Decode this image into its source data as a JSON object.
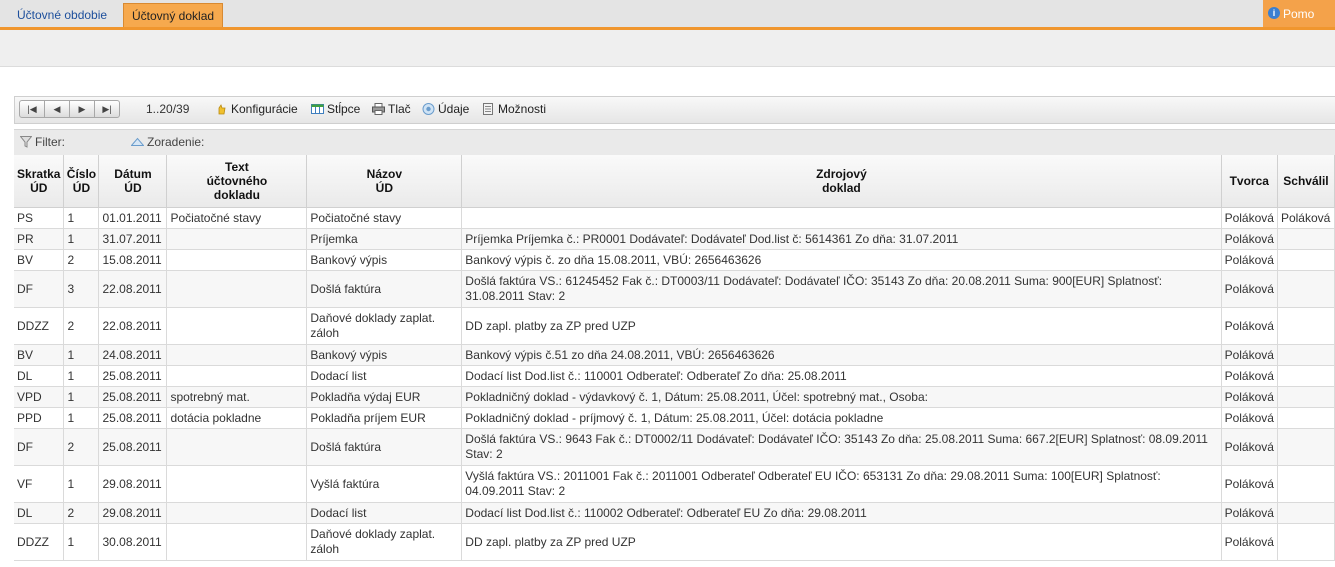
{
  "tabs": [
    {
      "label": "Účtovné obdobie",
      "active": false
    },
    {
      "label": "Účtovný doklad",
      "active": true
    }
  ],
  "help_label": "Pomo",
  "toolbar": {
    "page_info": "1..20/39",
    "konfiguracie": "Konfigurácie",
    "stlpce": "Stĺpce",
    "tlac": "Tlač",
    "udaje": "Údaje",
    "moznosti": "Možnosti"
  },
  "filterbar": {
    "filter": "Filter:",
    "zoradenie": "Zoradenie:"
  },
  "columns": [
    {
      "l1": "Skratka",
      "l2": "ÚD",
      "l3": ""
    },
    {
      "l1": "Číslo",
      "l2": "ÚD",
      "l3": ""
    },
    {
      "l1": "Dátum",
      "l2": "ÚD",
      "l3": ""
    },
    {
      "l1": "Text",
      "l2": "účtovného",
      "l3": "dokladu"
    },
    {
      "l1": "Názov",
      "l2": "ÚD",
      "l3": ""
    },
    {
      "l1": "Zdrojový",
      "l2": "doklad",
      "l3": ""
    },
    {
      "l1": "Tvorca",
      "l2": "",
      "l3": ""
    },
    {
      "l1": "Schválil",
      "l2": "",
      "l3": ""
    }
  ],
  "rows": [
    {
      "skratka": "PS",
      "cislo": "1",
      "datum": "01.01.2011",
      "text": "Počiatočné stavy",
      "nazov": "Počiatočné stavy",
      "zdroj": "",
      "tvorca": "Poláková",
      "schvalil": "Poláková"
    },
    {
      "skratka": "PR",
      "cislo": "1",
      "datum": "31.07.2011",
      "text": "",
      "nazov": "Príjemka",
      "zdroj": "Príjemka Príjemka č.: PR0001 Dodávateľ: Dodávateľ Dod.list č: 5614361 Zo dňa: 31.07.2011",
      "tvorca": "Poláková",
      "schvalil": ""
    },
    {
      "skratka": "BV",
      "cislo": "2",
      "datum": "15.08.2011",
      "text": "",
      "nazov": "Bankový výpis",
      "zdroj": "Bankový výpis č. zo dňa 15.08.2011, VBÚ: 2656463626",
      "tvorca": "Poláková",
      "schvalil": ""
    },
    {
      "skratka": "DF",
      "cislo": "3",
      "datum": "22.08.2011",
      "text": "",
      "nazov": "Došlá faktúra",
      "zdroj": "Došlá faktúra VS.: 61245452 Fak č.: DT0003/11 Dodávateľ: Dodávateľ IČO: 35143 Zo dňa: 20.08.2011 Suma: 900[EUR] Splatnosť: 31.08.2011 Stav: 2",
      "tvorca": "Poláková",
      "schvalil": ""
    },
    {
      "skratka": "DDZZ",
      "cislo": "2",
      "datum": "22.08.2011",
      "text": "",
      "nazov": "Daňové doklady zaplat. záloh",
      "zdroj": "DD zapl. platby za ZP pred UZP",
      "tvorca": "Poláková",
      "schvalil": ""
    },
    {
      "skratka": "BV",
      "cislo": "1",
      "datum": "24.08.2011",
      "text": "",
      "nazov": "Bankový výpis",
      "zdroj": "Bankový výpis č.51 zo dňa 24.08.2011, VBÚ: 2656463626",
      "tvorca": "Poláková",
      "schvalil": ""
    },
    {
      "skratka": "DL",
      "cislo": "1",
      "datum": "25.08.2011",
      "text": "",
      "nazov": "Dodací list",
      "zdroj": "Dodací list Dod.list č.: 110001 Odberateľ: Odberateľ Zo dňa: 25.08.2011",
      "tvorca": "Poláková",
      "schvalil": ""
    },
    {
      "skratka": "VPD",
      "cislo": "1",
      "datum": "25.08.2011",
      "text": "spotrebný mat.",
      "nazov": "Pokladňa výdaj EUR",
      "zdroj": "Pokladničný doklad - výdavkový č. 1, Dátum: 25.08.2011, Účel: spotrebný mat., Osoba:",
      "tvorca": "Poláková",
      "schvalil": ""
    },
    {
      "skratka": "PPD",
      "cislo": "1",
      "datum": "25.08.2011",
      "text": "dotácia pokladne",
      "nazov": "Pokladňa príjem EUR",
      "zdroj": "Pokladničný doklad - príjmový č. 1, Dátum: 25.08.2011, Účel: dotácia pokladne",
      "tvorca": "Poláková",
      "schvalil": ""
    },
    {
      "skratka": "DF",
      "cislo": "2",
      "datum": "25.08.2011",
      "text": "",
      "nazov": "Došlá faktúra",
      "zdroj": "Došlá faktúra VS.: 9643 Fak č.: DT0002/11 Dodávateľ: Dodávateľ IČO: 35143 Zo dňa: 25.08.2011 Suma: 667.2[EUR] Splatnosť: 08.09.2011 Stav: 2",
      "tvorca": "Poláková",
      "schvalil": ""
    },
    {
      "skratka": "VF",
      "cislo": "1",
      "datum": "29.08.2011",
      "text": "",
      "nazov": "Vyšlá faktúra",
      "zdroj": "Vyšlá faktúra VS.: 2011001 Fak č.: 2011001 Odberateľ Odberateľ EU IČO: 653131 Zo dňa: 29.08.2011 Suma: 100[EUR] Splatnosť: 04.09.2011 Stav: 2",
      "tvorca": "Poláková",
      "schvalil": ""
    },
    {
      "skratka": "DL",
      "cislo": "2",
      "datum": "29.08.2011",
      "text": "",
      "nazov": "Dodací list",
      "zdroj": "Dodací list Dod.list č.: 110002 Odberateľ: Odberateľ EU Zo dňa: 29.08.2011",
      "tvorca": "Poláková",
      "schvalil": ""
    },
    {
      "skratka": "DDZZ",
      "cislo": "1",
      "datum": "30.08.2011",
      "text": "",
      "nazov": "Daňové doklady zaplat. záloh",
      "zdroj": "DD zapl. platby za ZP pred UZP",
      "tvorca": "Poláková",
      "schvalil": ""
    }
  ]
}
